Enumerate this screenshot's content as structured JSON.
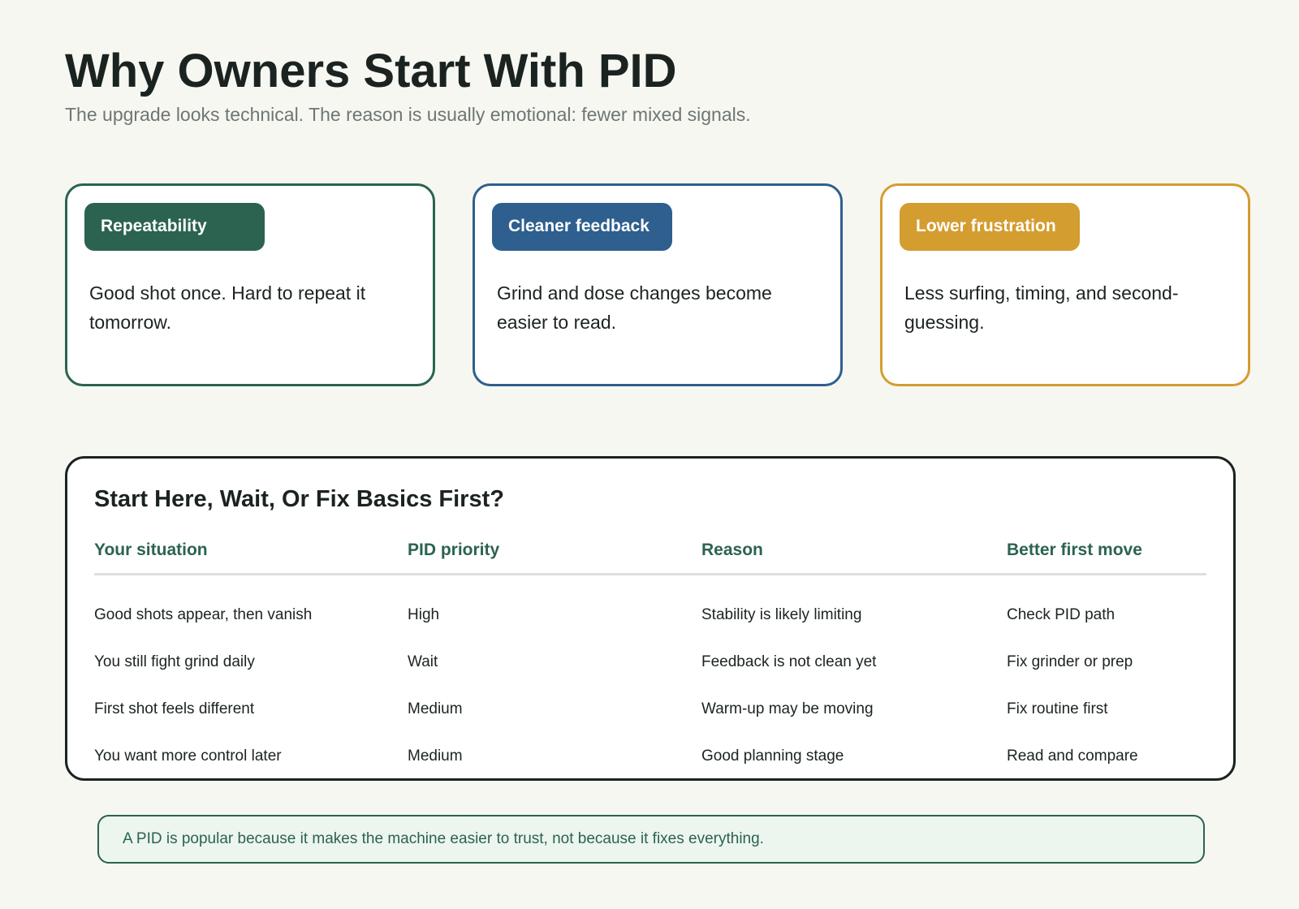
{
  "header": {
    "title": "Why Owners Start With PID",
    "subtitle": "The upgrade looks technical. The reason is usually emotional: fewer mixed signals."
  },
  "cards": [
    {
      "label": "Repeatability",
      "text": "Good shot once. Hard to repeat it tomorrow.",
      "color": "#2b6350"
    },
    {
      "label": "Cleaner feedback",
      "text": "Grind and dose changes become easier to read.",
      "color": "#2e5f8e"
    },
    {
      "label": "Lower frustration",
      "text": "Less surfing, timing, and second-guessing.",
      "color": "#d49d30"
    }
  ],
  "table": {
    "title": "Start Here, Wait, Or Fix Basics First?",
    "headers": [
      "Your situation",
      "PID priority",
      "Reason",
      "Better first move"
    ],
    "rows": [
      [
        "Good shots appear, then vanish",
        "High",
        "Stability is likely limiting",
        "Check PID path"
      ],
      [
        "You still fight grind daily",
        "Wait",
        "Feedback is not clean yet",
        "Fix grinder or prep"
      ],
      [
        "First shot feels different",
        "Medium",
        "Warm-up may be moving",
        "Fix routine first"
      ],
      [
        "You want more control later",
        "Medium",
        "Good planning stage",
        "Read and compare"
      ]
    ]
  },
  "note": "A PID is popular because it makes the machine easier to trust, not because it fixes everything."
}
